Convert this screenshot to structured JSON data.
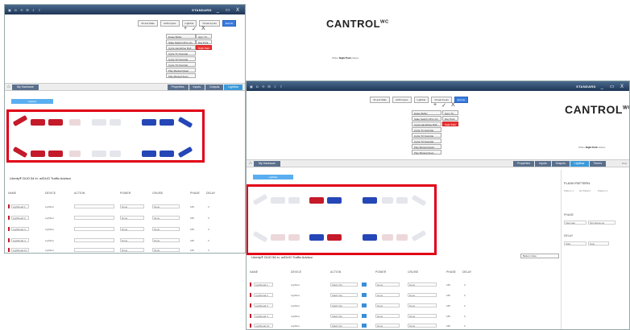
{
  "qa_icons": [
    "▣",
    "⎌",
    "⟲",
    "⊞",
    "⇩",
    "⇧"
  ],
  "window_controls": "_ ▭ X",
  "w1": {
    "title": "STANDARD",
    "ribbon_tabs": [
      {
        "label": "JS and Slide"
      },
      {
        "label": "ACM Inputs"
      },
      {
        "label": "Lightbar",
        "active": false
      },
      {
        "label": "Virtual Inputs"
      },
      {
        "label": "Events",
        "active": true
      }
    ],
    "ops": [
      "+",
      "✓",
      "X"
    ],
    "op_col1": [
      "Erase Buffer",
      "State Switch Off to On",
      "Cycle Handsfree Buff...",
      "Cycle T1 Override",
      "Cycle T2 Override",
      "Cycle T3 Override",
      "Play Manual Quad",
      "Play Manual Soun..."
    ],
    "op_col2": [
      "Sync Tri...",
      "Day Park",
      "Night Park"
    ],
    "brand": "CANTROL",
    "brand_sup": "WC",
    "when_prefix": "When",
    "when_value": "Night Park",
    "when_suffix": "raised.",
    "nav_label": "My Hardware",
    "nav_tabs": [
      {
        "label": "Properties"
      },
      {
        "label": "Inputs"
      },
      {
        "label": "Outputs"
      },
      {
        "label": "Lightbar",
        "active": true
      }
    ],
    "subtab": "Lightbar",
    "section_title": "Liberty® DUO 54 in. w/DUO Traffic Advisor",
    "col_headers": [
      "NAME",
      "DEVICE",
      "ACTION",
      "POWER",
      "CRUISE",
      "PHASE",
      "DELAY"
    ],
    "rows": [
      {
        "name": "Lighthead 1",
        "device": "Lightbar",
        "action": "",
        "power": "None",
        "cruise": "None",
        "phase": "180",
        "delay": "0"
      },
      {
        "name": "Lighthead 2",
        "device": "Lightbar",
        "action": "",
        "power": "None",
        "cruise": "None",
        "phase": "180",
        "delay": "0"
      },
      {
        "name": "Lighthead 3",
        "device": "Lightbar",
        "action": "",
        "power": "None",
        "cruise": "None",
        "phase": "180",
        "delay": "0"
      },
      {
        "name": "Lighthead 4",
        "device": "Lightbar",
        "action": "",
        "power": "None",
        "cruise": "None",
        "phase": "180",
        "delay": "0"
      },
      {
        "name": "Lighthead 10",
        "device": "Lightbar",
        "action": "",
        "power": "None",
        "cruise": "None",
        "phase": "180",
        "delay": "0"
      }
    ]
  },
  "w2": {
    "title": "STANDARD",
    "ribbon_tabs": [
      {
        "label": "JS and Slide"
      },
      {
        "label": "ACM Inputs"
      },
      {
        "label": "Lightbar"
      },
      {
        "label": "Virtual Inputs"
      },
      {
        "label": "Events",
        "active": true
      }
    ],
    "ops": [
      "+",
      "✓",
      "X"
    ],
    "op_col1": [
      "Erase Buffer",
      "State Switch Off to On",
      "Cycle Handsfree Buff...",
      "Cycle T1 Override",
      "Cycle T2 Override",
      "Cycle T3 Override",
      "Play Manual Quad",
      "Play Manual Soun..."
    ],
    "op_col2": [
      "Sync Tri...",
      "Day Park",
      "Night Park"
    ],
    "brand": "CANTROL",
    "brand_sup": "WC",
    "when_prefix": "When",
    "when_value": "Night Park",
    "when_suffix": "raised.",
    "nav_label": "My Hardware",
    "nav_tabs": [
      {
        "label": "Properties"
      },
      {
        "label": "Inputs"
      },
      {
        "label": "Outputs"
      },
      {
        "label": "Lightbar",
        "active": true
      },
      {
        "label": "Timers"
      }
    ],
    "nav_right": "Pins",
    "subtab": "Lightbar",
    "section_title": "Liberty® DUO 54 in. w/DUO Traffic Advisor",
    "view_dropdown": "Bottom View",
    "col_headers": [
      "NAME",
      "DEVICE",
      "ACTION",
      "POWER",
      "CRUISE",
      "PHASE",
      "DELAY"
    ],
    "rows": [
      {
        "name": "Lighthead 1",
        "device": "Lightbar",
        "action": "Flash Out",
        "power": "None",
        "cruise": "None",
        "phase": "180",
        "delay": "0"
      },
      {
        "name": "Lighthead 2",
        "device": "Lightbar",
        "action": "Flash Out",
        "power": "None",
        "cruise": "None",
        "phase": "180",
        "delay": "0"
      },
      {
        "name": "Lighthead 3",
        "device": "Lightbar",
        "action": "Flash Out",
        "power": "None",
        "cruise": "None",
        "phase": "180",
        "delay": "0"
      },
      {
        "name": "Lighthead 4",
        "device": "Lightbar",
        "action": "Flash Out",
        "power": "None",
        "cruise": "None",
        "phase": "180",
        "delay": "0"
      },
      {
        "name": "Lighthead 10",
        "device": "Lightbar",
        "action": "Flash Out",
        "power": "None",
        "cruise": "None",
        "phase": "180",
        "delay": "0"
      }
    ],
    "flash_title": "FLASH PATTERN",
    "flash_options": [
      "Pattern 1",
      "No Pattern",
      "Pattern 2"
    ],
    "phase_label": "PHASE",
    "phase_options": [
      "Alternate",
      "Simultaneous"
    ],
    "delay_label": "DELAY",
    "delay_options": [
      "Start",
      "Stop"
    ]
  }
}
